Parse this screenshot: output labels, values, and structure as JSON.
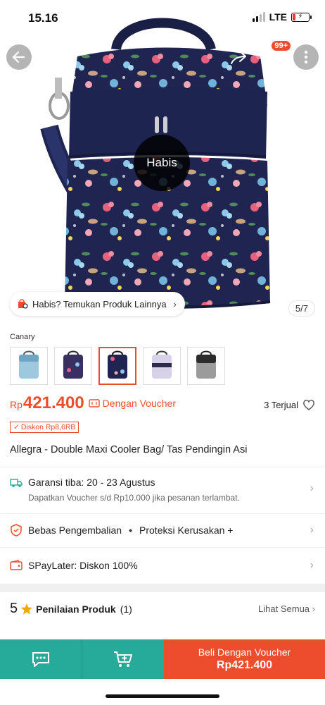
{
  "status": {
    "time": "15.16",
    "network": "LTE"
  },
  "nav": {
    "cart_badge": "99+"
  },
  "product_image": {
    "soldout_label": "Habis",
    "find_banner": "Habis? Temukan Produk Lainnya",
    "counter": "5/7"
  },
  "variants": {
    "label": "Canary",
    "count": 5,
    "selected_index": 2
  },
  "price": {
    "currency": "Rp",
    "value": "421.400",
    "voucher_note": "Dengan Voucher",
    "sold": "3 Terjual",
    "discount_badge": "Diskon Rp8,6RB"
  },
  "product_title": "Allegra - Double Maxi Cooler Bag/ Tas Pendingin Asi",
  "shipping": {
    "label": "Garansi tiba: 20 - 23 Agustus",
    "sub": "Dapatkan Voucher s/d Rp10.000 jika pesanan terlambat."
  },
  "protection": {
    "left": "Bebas Pengembalian",
    "sep": "•",
    "right": "Proteksi Kerusakan +"
  },
  "paylater": {
    "label": "SPayLater: Diskon 100%"
  },
  "rating": {
    "score": "5",
    "label": "Penilaian Produk",
    "count": "(1)",
    "see_all": "Lihat Semua"
  },
  "bottom_bar": {
    "buy_line1": "Beli Dengan Voucher",
    "buy_line2": "Rp421.400"
  },
  "colors": {
    "accent": "#ee4d2d",
    "teal": "#26aa99",
    "bag_navy": "#1f2550"
  }
}
